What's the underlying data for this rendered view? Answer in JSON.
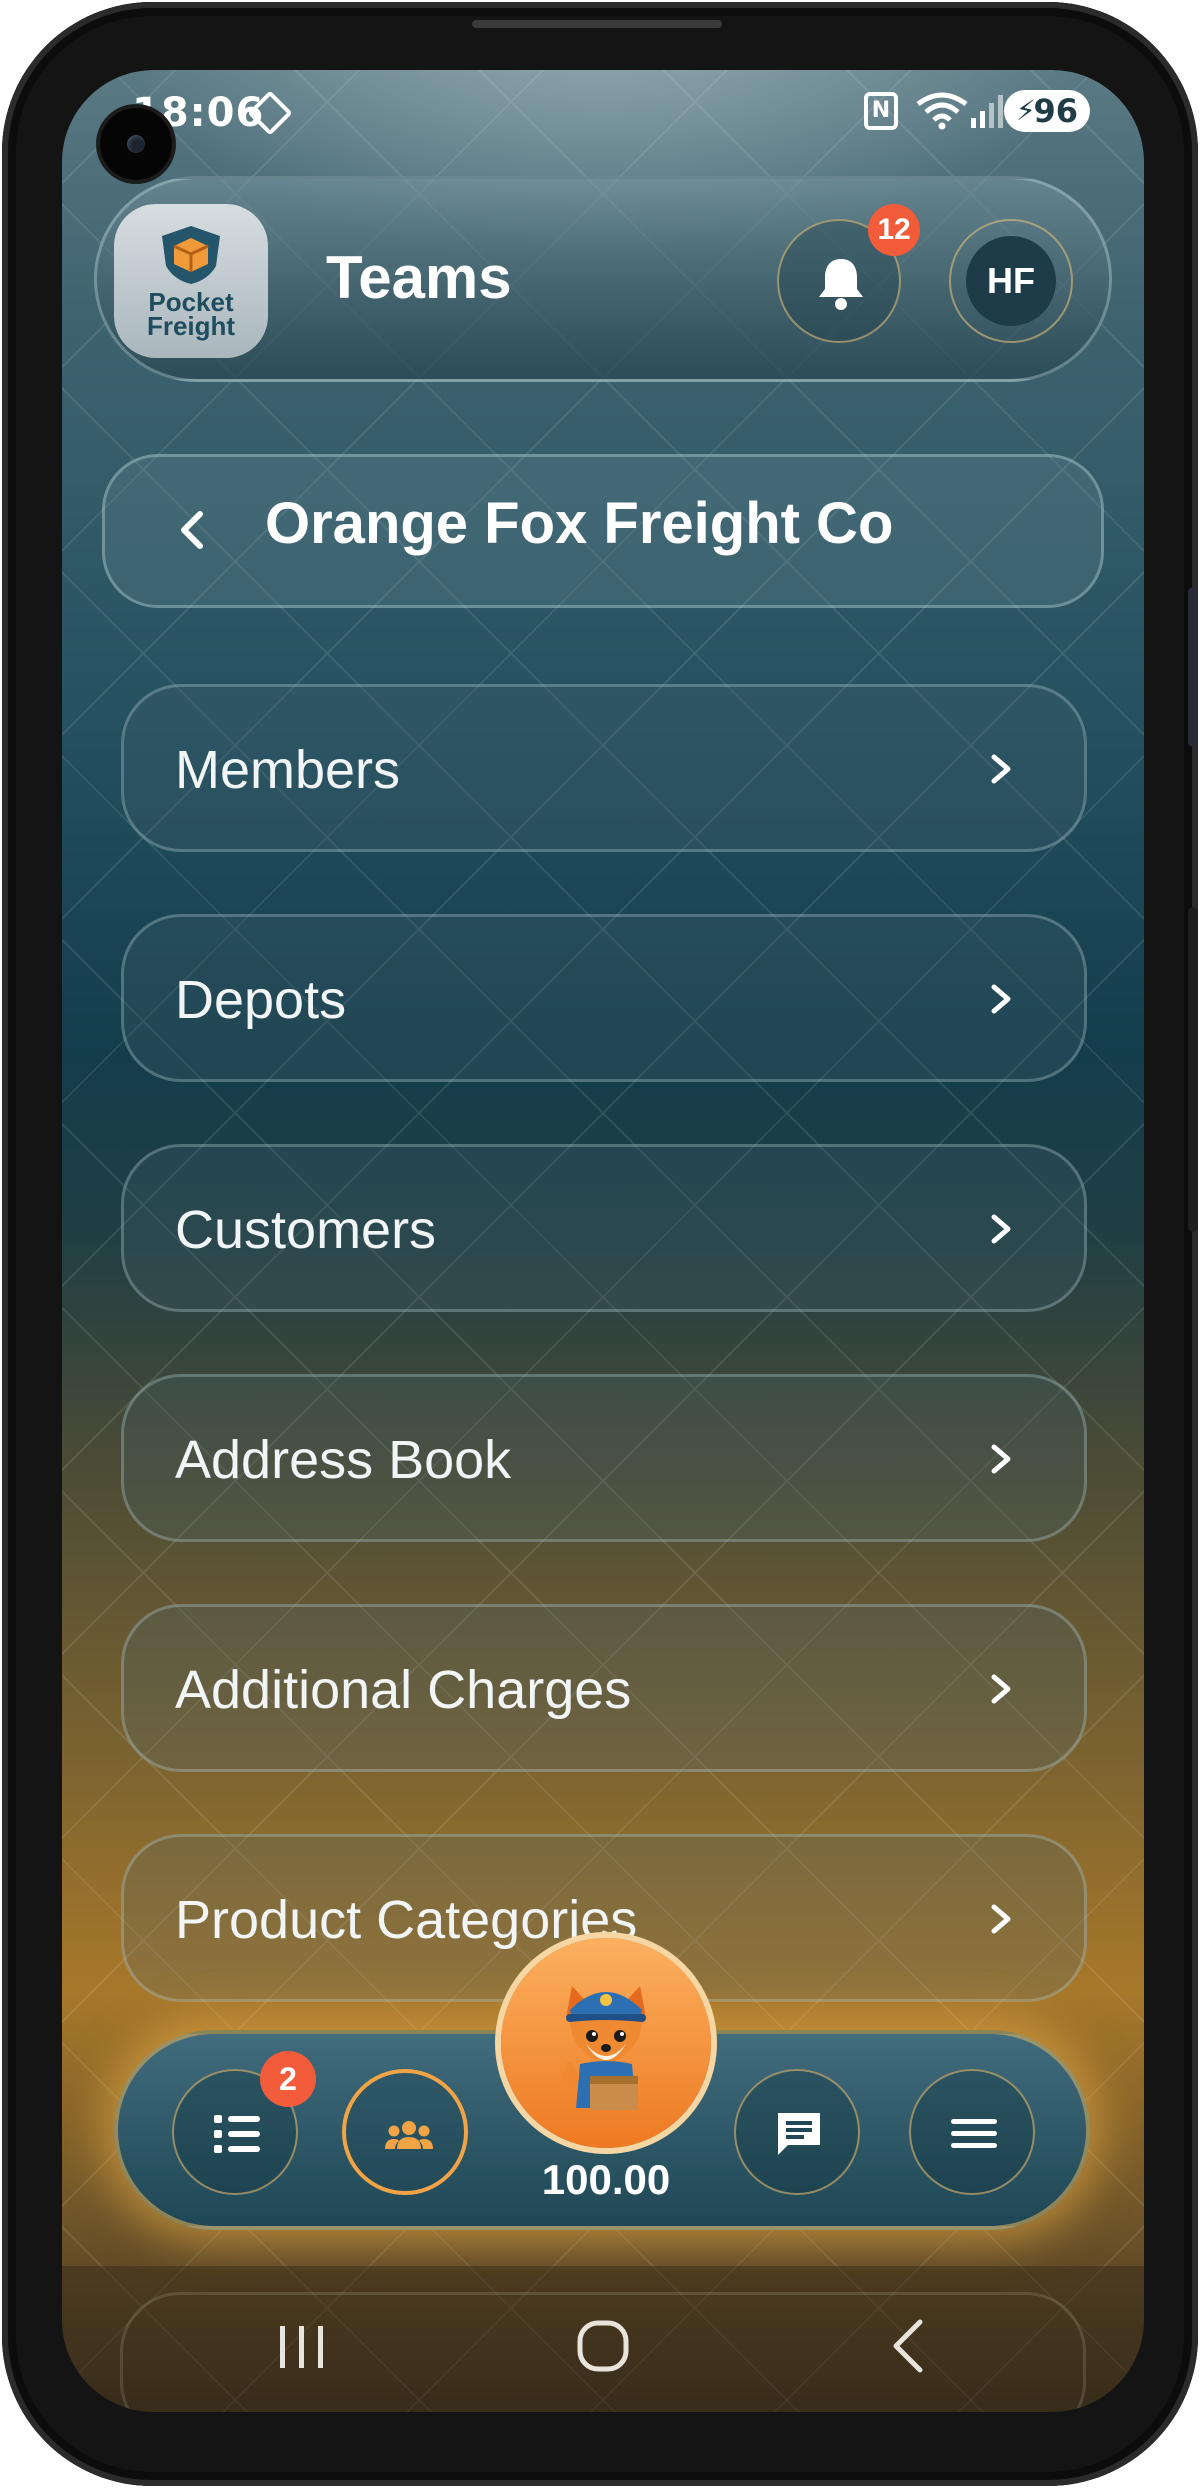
{
  "status_bar": {
    "time": "18:06",
    "battery": "96"
  },
  "header": {
    "logo_text_line1": "Pocket",
    "logo_text_line2": "Freight",
    "title": "Teams",
    "notification_count": "12",
    "avatar_initials": "HF"
  },
  "company": {
    "name": "Orange Fox Freight Co"
  },
  "menu": {
    "items": [
      {
        "label": "Members"
      },
      {
        "label": "Depots"
      },
      {
        "label": "Customers"
      },
      {
        "label": "Address Book"
      },
      {
        "label": "Additional Charges"
      },
      {
        "label": "Product Categories"
      }
    ]
  },
  "bottom_nav": {
    "jobs_badge": "2",
    "balance": "100.00",
    "active_tab": "teams",
    "icons": [
      "list-icon",
      "team-icon",
      "fox-mascot",
      "chat-icon",
      "menu-icon"
    ]
  },
  "colors": {
    "accent": "#f1a446",
    "badge": "#f25c3b",
    "header_bg": "#2c5a68"
  }
}
